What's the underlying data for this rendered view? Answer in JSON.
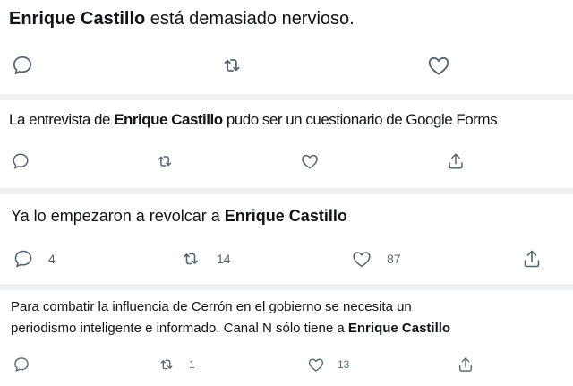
{
  "tweets": [
    {
      "author_mention": "Enrique Castillo",
      "text_after": " está demasiado nervioso.",
      "counts": {}
    },
    {
      "text_before": "La entrevista de ",
      "author_mention": "Enrique Castillo",
      "text_after": " pudo ser un cuestionario de Google Forms",
      "counts": {}
    },
    {
      "text_before": "Ya lo empezaron a revolcar a ",
      "author_mention": "Enrique Castillo",
      "counts": {
        "replies": "4",
        "retweets": "14",
        "likes": "87"
      }
    },
    {
      "line1": "Para combatir la influencia de Cerrón en el gobierno se necesita un",
      "line2_before": "periodismo inteligente e informado. Canal N sólo tiene a ",
      "author_mention": "Enrique Castillo",
      "counts": {
        "retweets": "1",
        "likes": "13"
      }
    }
  ],
  "icons": [
    "reply-icon",
    "retweet-icon",
    "like-icon",
    "share-icon"
  ],
  "colors": {
    "icon": "#536471",
    "text": "#0f1419",
    "separator": "#eef0f2"
  }
}
